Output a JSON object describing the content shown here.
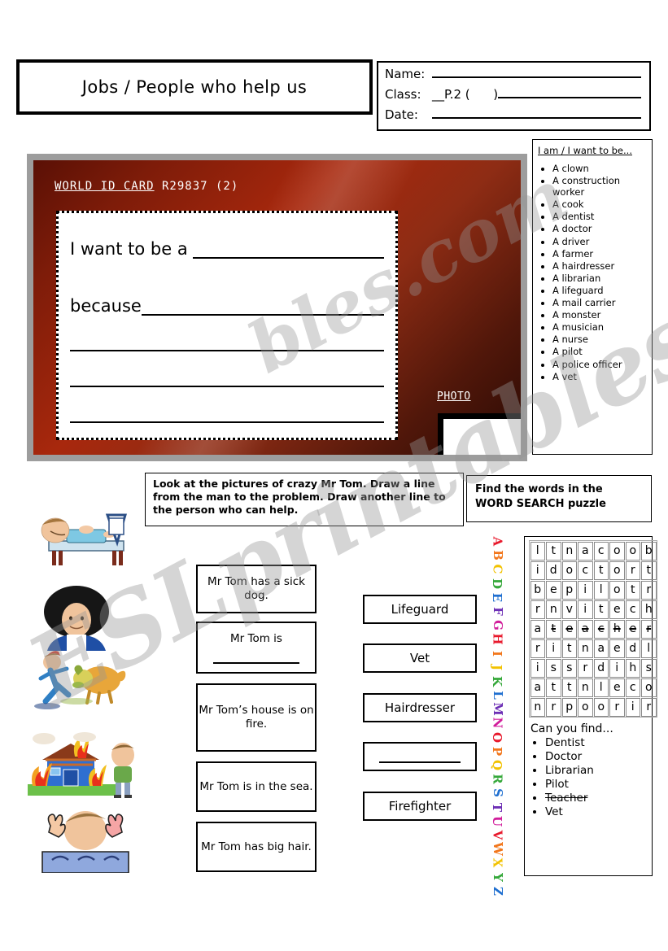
{
  "header": {
    "title": "Jobs / People who help us",
    "info": {
      "name_label": "Name:",
      "class_label": "Class:",
      "class_value": "__P.2 (      )",
      "date_label": "Date:"
    }
  },
  "id_card": {
    "title_underlined": "WORLD ID CARD",
    "title_rest": " R29837  (2)",
    "line1_lead": "I want to be a ",
    "line2_lead": "because",
    "photo_label": "PHOTO"
  },
  "job_list": {
    "heading": "I am / I want to be...",
    "items": [
      "A clown",
      "A construction worker",
      "A cook",
      "A dentist",
      "A doctor",
      "A driver",
      "A farmer",
      "A hairdresser",
      "A librarian",
      "A lifeguard",
      "A mail carrier",
      "A monster",
      "A musician",
      "A nurse",
      "A pilot",
      "A police officer",
      "A vet"
    ]
  },
  "instructions": {
    "matching": "Look at the pictures of crazy Mr Tom. Draw a line from the man to the problem. Draw another line to the person who can help.",
    "wordsearch_line1": "Find the words in the",
    "wordsearch_line2": "WORD SEARCH puzzle"
  },
  "pictures": [
    {
      "name": "man-in-hospital-bed"
    },
    {
      "name": "man-with-big-afro-hair"
    },
    {
      "name": "man-running-from-dog"
    },
    {
      "name": "house-on-fire"
    },
    {
      "name": "man-standing"
    },
    {
      "name": "man-drowning-in-sea"
    }
  ],
  "problems": [
    {
      "text": "Mr Tom has a sick dog.",
      "blank": false
    },
    {
      "text": "Mr Tom is",
      "blank": true
    },
    {
      "text": "Mr Tom’s house is on fire.",
      "blank": false
    },
    {
      "text": "Mr Tom is in the sea.",
      "blank": false
    },
    {
      "text": "Mr Tom has big hair.",
      "blank": false
    }
  ],
  "helpers": [
    {
      "text": "Lifeguard",
      "blank": false
    },
    {
      "text": "Vet",
      "blank": false
    },
    {
      "text": "Hairdresser",
      "blank": false
    },
    {
      "text": "",
      "blank": true
    },
    {
      "text": "Firefighter",
      "blank": false
    }
  ],
  "alphabet": {
    "letters": [
      "A",
      "B",
      "C",
      "D",
      "E",
      "F",
      "G",
      "H",
      "I",
      "J",
      "K",
      "L",
      "M",
      "N",
      "O",
      "P",
      "Q",
      "R",
      "S",
      "T",
      "U",
      "V",
      "W",
      "X",
      "Y",
      "Z"
    ],
    "colors": [
      "#e8192c",
      "#f2761b",
      "#f2c200",
      "#35a83a",
      "#1f6fd0",
      "#6d2fb5",
      "#d11d9b",
      "#e8192c",
      "#f2761b",
      "#f2c200",
      "#35a83a",
      "#1f6fd0",
      "#6d2fb5",
      "#d11d9b",
      "#e8192c",
      "#f2761b",
      "#f2c200",
      "#35a83a",
      "#1f6fd0",
      "#6d2fb5",
      "#d11d9b",
      "#e8192c",
      "#f2761b",
      "#f2c200",
      "#35a83a",
      "#1f6fd0"
    ]
  },
  "word_search": {
    "rows": [
      "ltnacoob",
      "idoctort",
      "bepilotr",
      "rnvitech",
      "ateacher",
      "ritnaedl",
      "issrdihs",
      "attnleco",
      "nrpoorir"
    ],
    "struck_cells": [
      {
        "row": 4,
        "from": 1,
        "to": 7
      }
    ],
    "find_heading": "Can you find...",
    "find_words": [
      {
        "word": "Dentist",
        "found": false
      },
      {
        "word": "Doctor",
        "found": false
      },
      {
        "word": "Librarian",
        "found": false
      },
      {
        "word": "Pilot",
        "found": false
      },
      {
        "word": "Teacher",
        "found": true
      },
      {
        "word": "Vet",
        "found": false
      }
    ]
  },
  "watermark": {
    "line1": "ESLprintables.com",
    "line2": "bles.com"
  }
}
